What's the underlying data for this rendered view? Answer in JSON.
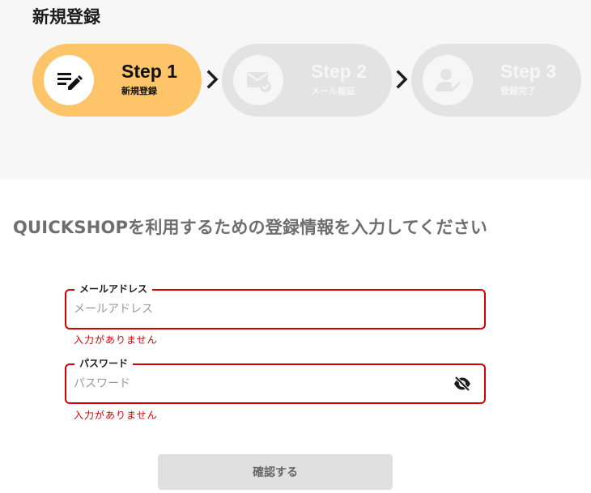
{
  "page": {
    "title": "新規登録"
  },
  "steps": [
    {
      "number": "Step 1",
      "label": "新規登録",
      "icon": "edit-note-icon",
      "state": "active"
    },
    {
      "number": "Step 2",
      "label": "メール認証",
      "icon": "mail-check-icon",
      "state": "inactive"
    },
    {
      "number": "Step 3",
      "label": "登録完了",
      "icon": "user-check-icon",
      "state": "inactive"
    }
  ],
  "form": {
    "subtitle": "QUICKSHOPを利用するための登録情報を入力してください",
    "email": {
      "label": "メールアドレス",
      "placeholder": "メールアドレス",
      "value": "",
      "error": "入力がありません"
    },
    "password": {
      "label": "パスワード",
      "placeholder": "パスワード",
      "value": "",
      "error": "入力がありません",
      "toggle_icon": "eye-off-icon"
    },
    "submit_label": "確認する"
  },
  "colors": {
    "active_step": "#fdc46a",
    "inactive_step": "#e3e3e3",
    "error": "#d60000",
    "button_disabled": "#e0e0e0"
  }
}
